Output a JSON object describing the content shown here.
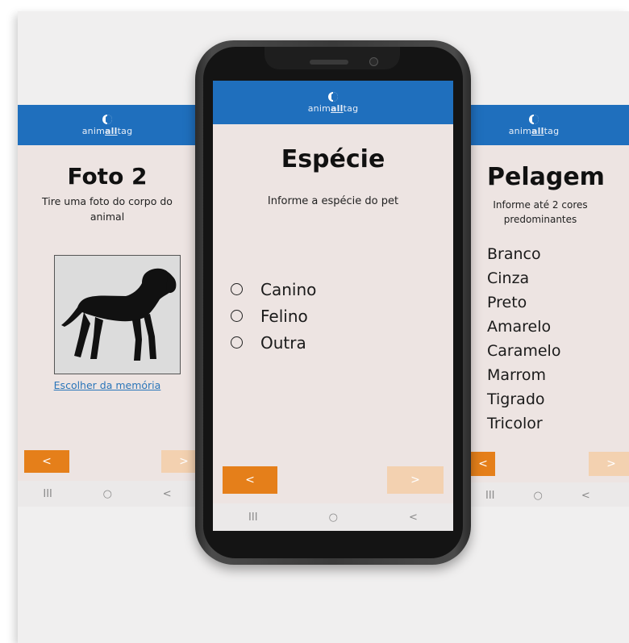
{
  "brand": {
    "logo_prefix": "anim",
    "logo_highlight": "all",
    "logo_suffix": "tag"
  },
  "left_screen": {
    "title": "Foto 2",
    "subtitle": "Tire uma foto do corpo do animal",
    "link": "Escolher da memória",
    "back_label": "<",
    "next_label": ">",
    "nav": {
      "recents": "III",
      "home": "○",
      "back": "<"
    }
  },
  "center_screen": {
    "title": "Espécie",
    "subtitle": "Informe a espécie do pet",
    "options": [
      "Canino",
      "Felino",
      "Outra"
    ],
    "back_label": "<",
    "next_label": ">",
    "nav": {
      "recents": "III",
      "home": "○",
      "back": "<"
    }
  },
  "right_screen": {
    "title": "Pelagem",
    "subtitle": "Informe até 2 cores predominantes",
    "colors": [
      "Branco",
      "Cinza",
      "Preto",
      "Amarelo",
      "Caramelo",
      "Marrom",
      "Tigrado",
      "Tricolor"
    ],
    "back_label": "<",
    "next_label": ">",
    "nav": {
      "recents": "III",
      "home": "○",
      "back": "<"
    }
  },
  "theme": {
    "appbar": "#1f6fbd",
    "back_button": "#e57f1a",
    "next_button_disabled": "#f3d1b0",
    "screen_bg": "#ede4e2"
  }
}
